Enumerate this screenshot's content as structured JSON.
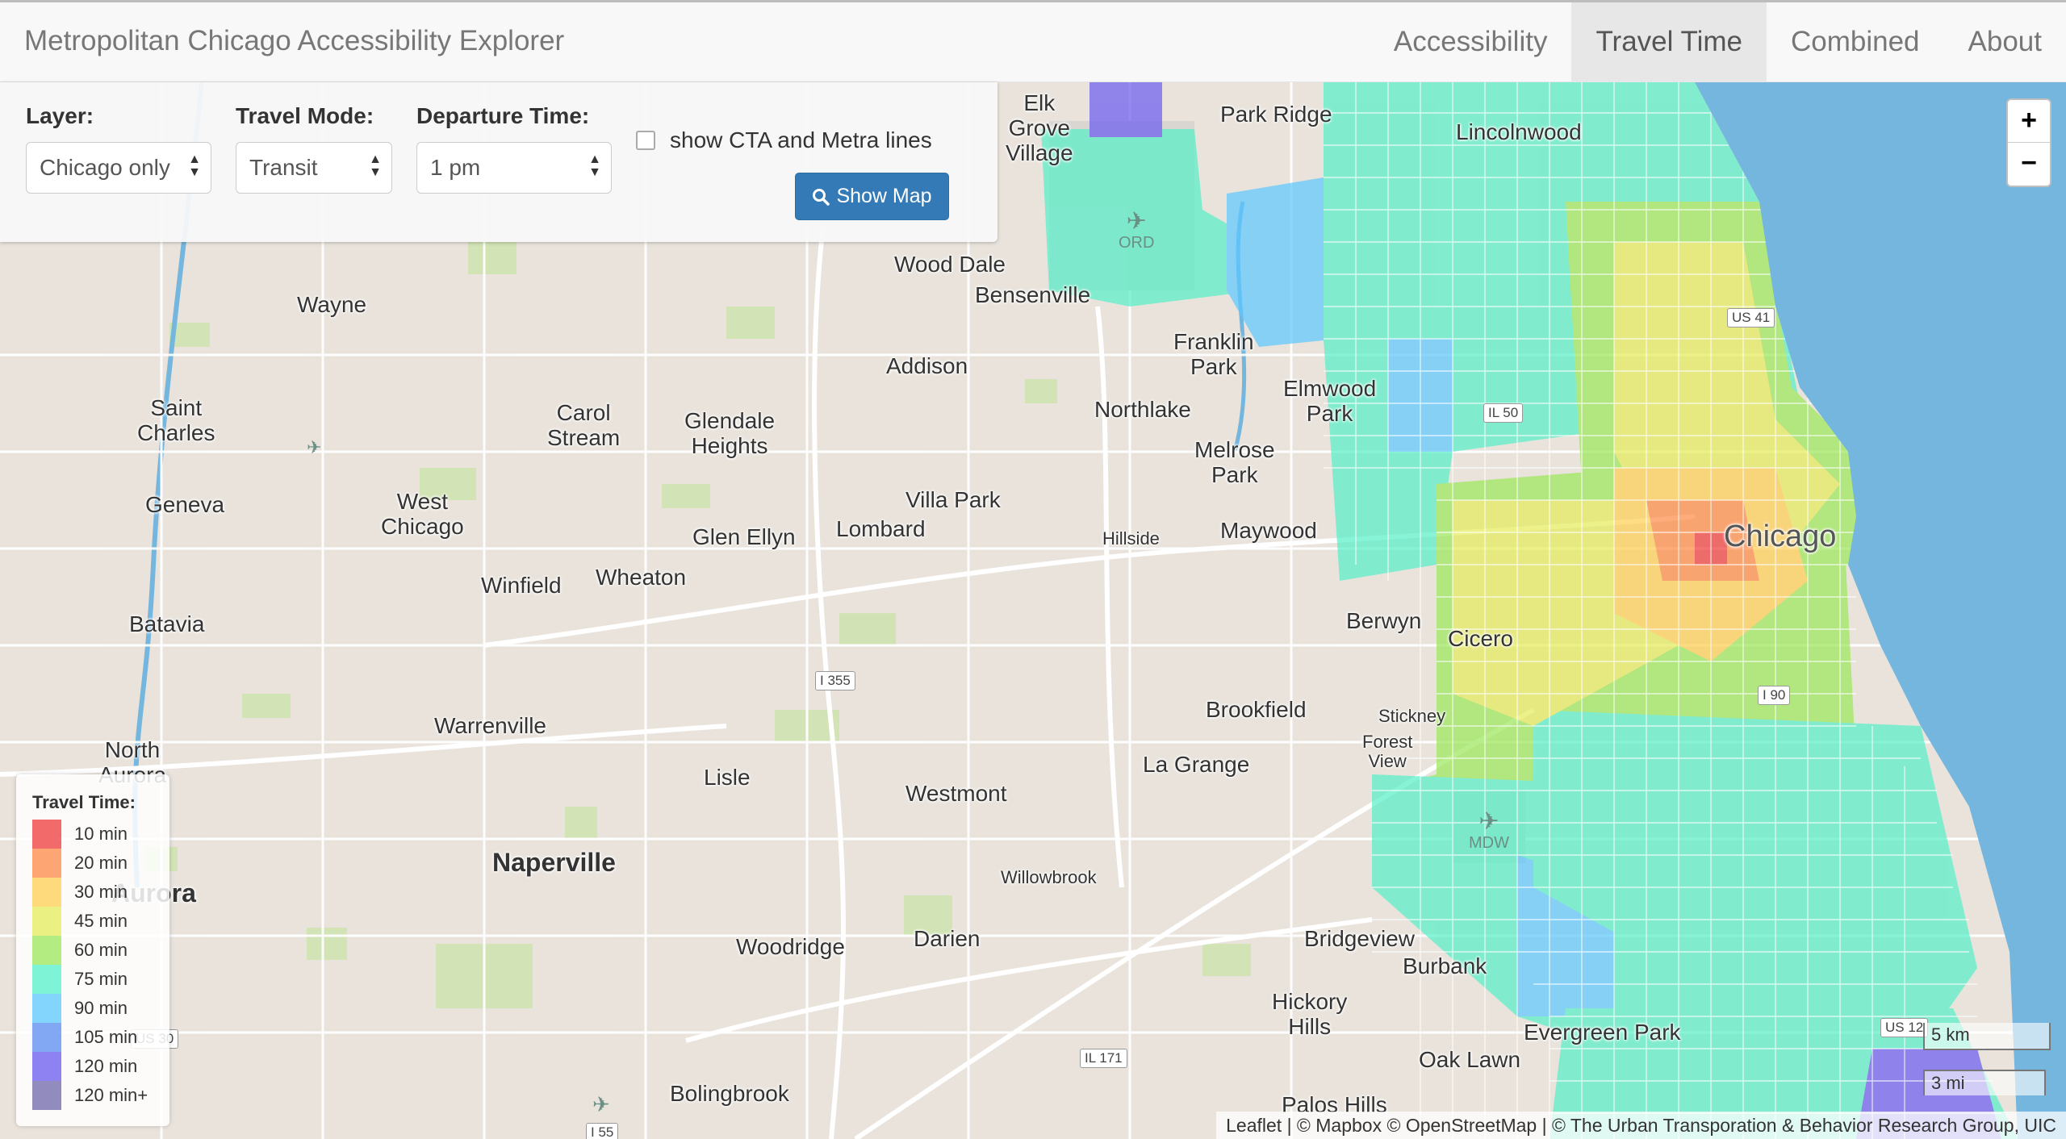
{
  "navbar": {
    "brand": "Metropolitan Chicago Accessibility Explorer",
    "items": [
      {
        "label": "Accessibility",
        "active": false
      },
      {
        "label": "Travel Time",
        "active": true
      },
      {
        "label": "Combined",
        "active": false
      },
      {
        "label": "About",
        "active": false
      }
    ]
  },
  "controls": {
    "layer": {
      "label": "Layer:",
      "value": "Chicago only"
    },
    "mode": {
      "label": "Travel Mode:",
      "value": "Transit"
    },
    "departure": {
      "label": "Departure Time:",
      "value": "1 pm"
    },
    "show_lines": {
      "label": "show CTA and Metra lines",
      "checked": false
    },
    "show_map_button": "Show Map",
    "show_map_icon": "search-icon"
  },
  "zoom": {
    "in": "+",
    "out": "−"
  },
  "legend": {
    "title": "Travel Time:",
    "items": [
      {
        "label": "10 min",
        "color": "#f03a3a"
      },
      {
        "label": "20 min",
        "color": "#ff8a45"
      },
      {
        "label": "30 min",
        "color": "#ffcf52"
      },
      {
        "label": "45 min",
        "color": "#e6ec5a"
      },
      {
        "label": "60 min",
        "color": "#9be858"
      },
      {
        "label": "75 min",
        "color": "#55f0c8"
      },
      {
        "label": "90 min",
        "color": "#5bc8ff"
      },
      {
        "label": "105 min",
        "color": "#5a8cf0"
      },
      {
        "label": "120 min",
        "color": "#6a5af0"
      },
      {
        "label": "120 min+",
        "color": "#6f66aa"
      }
    ]
  },
  "map": {
    "places": {
      "elk_grove_village": "Elk\nGrove\nVillage",
      "park_ridge": "Park Ridge",
      "lincolnwood": "Lincolnwood",
      "wood_dale": "Wood Dale",
      "bensenville": "Bensenville",
      "wayne": "Wayne",
      "franklin_park": "Franklin\nPark",
      "addison": "Addison",
      "elmwood_park": "Elmwood\nPark",
      "saint_charles": "Saint\nCharles",
      "carol_stream": "Carol\nStream",
      "glendale_heights": "Glendale\nHeights",
      "northlake": "Northlake",
      "melrose_park": "Melrose\nPark",
      "geneva": "Geneva",
      "west_chicago": "West\nChicago",
      "villa_park": "Villa Park",
      "glen_ellyn": "Glen Ellyn",
      "lombard": "Lombard",
      "hillside": "Hillside",
      "maywood": "Maywood",
      "chicago": "Chicago",
      "winfield": "Winfield",
      "wheaton": "Wheaton",
      "batavia": "Batavia",
      "berwyn": "Berwyn",
      "cicero": "Cicero",
      "brookfield": "Brookfield",
      "stickney": "Stickney",
      "warrenville": "Warrenville",
      "north_aurora": "North\nAurora",
      "forest_view": "Forest\nView",
      "lisle": "Lisle",
      "la_grange": "La Grange",
      "westmont": "Westmont",
      "naperville": "Naperville",
      "willowbrook": "Willowbrook",
      "aurora": "Aurora",
      "woodridge": "Woodridge",
      "darien": "Darien",
      "bridgeview": "Bridgeview",
      "burbank": "Burbank",
      "hickory_hills": "Hickory\nHills",
      "evergreen_park": "Evergreen Park",
      "oak_lawn": "Oak Lawn",
      "bolingbrook": "Bolingbrook",
      "palos_hills": "Palos Hills"
    },
    "shields": {
      "i355": "I 355",
      "i90": "I 90",
      "il50": "IL 50",
      "us41": "US 41",
      "il171": "IL 171",
      "us12": "US 12",
      "us30": "US 30",
      "i55": "I 55"
    },
    "airports": {
      "ord": "ORD",
      "mdw": "MDW"
    },
    "colors": {
      "water": "#75b6df",
      "land": "#e9e3dc",
      "park": "#cfe3b0"
    }
  },
  "scale": {
    "km": "5 km",
    "mi": "3 mi"
  },
  "attribution": "Leaflet | © Mapbox © OpenStreetMap | © The Urban Transporation & Behavior Research Group, UIC"
}
